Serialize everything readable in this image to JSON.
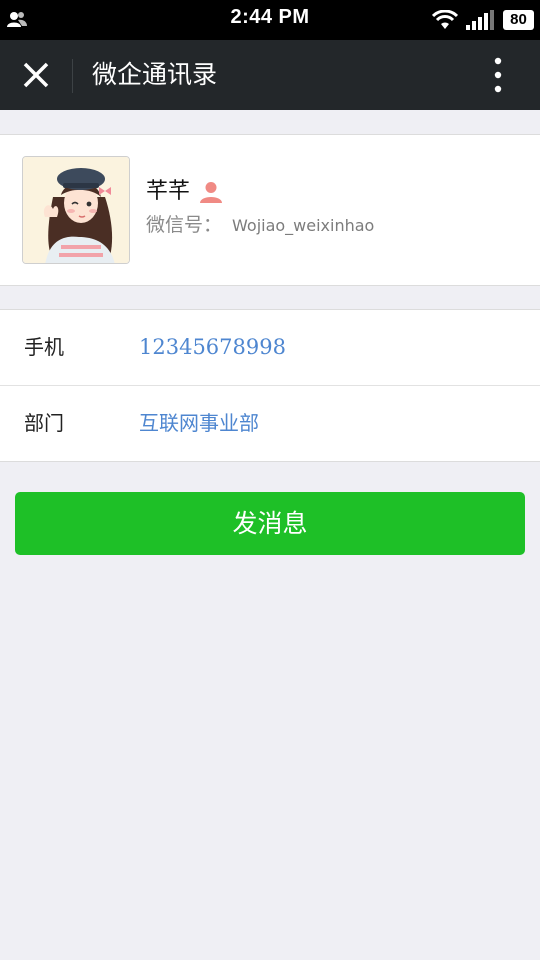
{
  "status_bar": {
    "time": "2:44 PM",
    "battery": "80",
    "icons": [
      "contacts-icon",
      "wifi-icon",
      "signal-icon",
      "battery-icon"
    ]
  },
  "nav": {
    "title": "微企通讯录",
    "close_icon": "close-icon",
    "more_icon": "more-vertical-icon"
  },
  "profile": {
    "name": "芊芊",
    "gender_icon": "person-icon",
    "wechat_label": "微信号：",
    "wechat_id": "Wojiao_weixinhao"
  },
  "info": {
    "rows": [
      {
        "label": "手机",
        "value": "12345678998"
      },
      {
        "label": "部门",
        "value": "互联网事业部"
      }
    ]
  },
  "actions": {
    "send_message": "发消息"
  },
  "colors": {
    "nav_bg": "#23272a",
    "accent_green": "#1ec027",
    "link_blue": "#4e86d0",
    "page_bg": "#efeff4",
    "gender_icon": "#f08a84"
  }
}
